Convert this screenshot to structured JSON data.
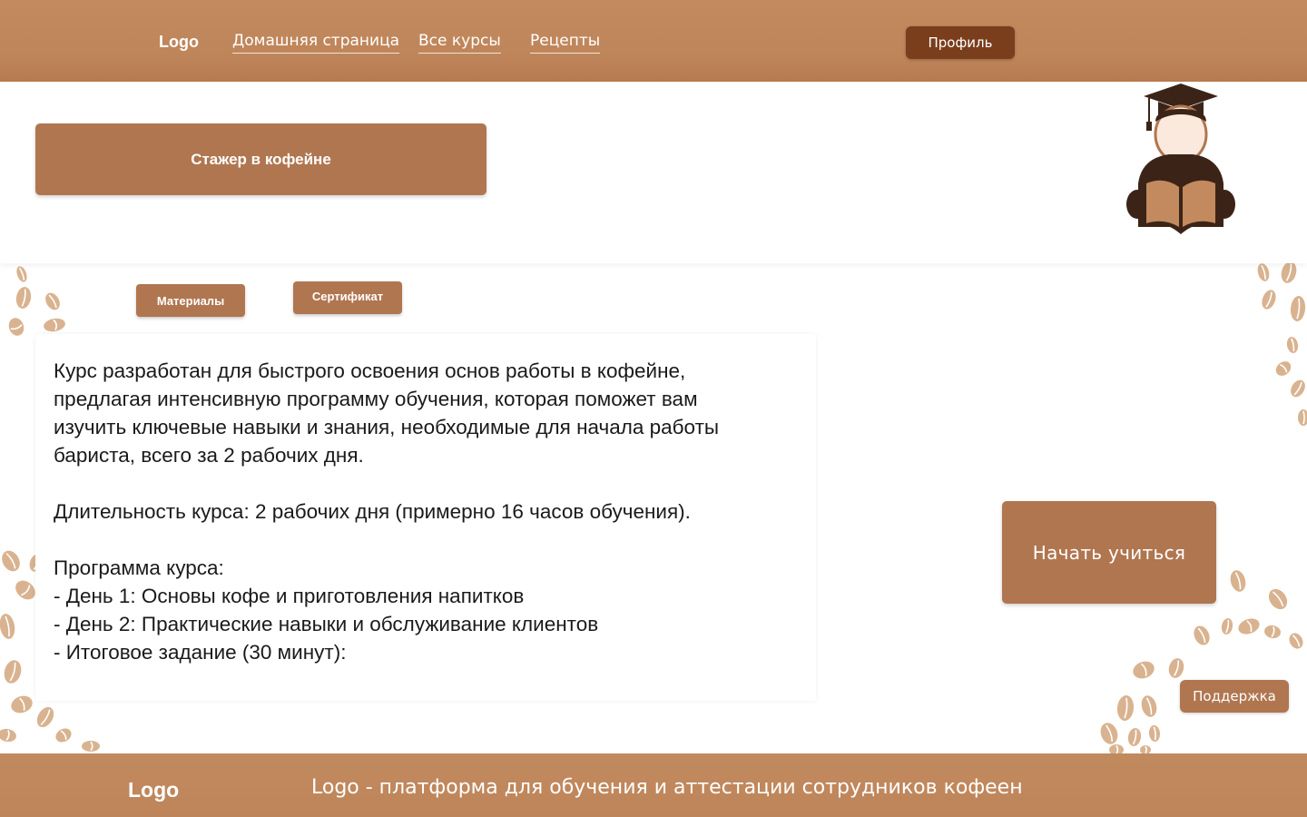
{
  "header": {
    "logo": "Logo",
    "nav": {
      "home": "Домашняя страница",
      "courses": "Все курсы",
      "recipes": "Рецепты"
    },
    "profile_label": "Профиль"
  },
  "course": {
    "title": "Стажер в кофейне",
    "illustration_icon": "graduate-reading-book-icon"
  },
  "tabs": {
    "materials": "Материалы",
    "certificate": "Сертификат"
  },
  "description": {
    "intro_lines": [
      "Курс разработан для быстрого освоения основ работы в кофейне,",
      "предлагая интенсивную программу обучения, которая поможет вам",
      "изучить ключевые навыки и знания, необходимые для начала работы",
      "бариста, всего за 2 рабочих дня."
    ],
    "duration": "Длительность курса: 2 рабочих дня (примерно 16 часов обучения).",
    "program_heading": "Программа курса:",
    "program_items": [
      "- День 1: Основы кофе и приготовления напитков",
      "- День 2: Практические навыки и обслуживание клиентов",
      "- Итоговое задание (30 минут):"
    ]
  },
  "actions": {
    "start_label": "Начать учиться",
    "support_label": "Поддержка"
  },
  "footer": {
    "logo": "Logo",
    "tagline": "Logo - платформа для обучения и аттестации сотрудников кофеен"
  },
  "colors": {
    "header_bg": "#bf855a",
    "accent": "#b07650",
    "profile_bg": "#7a3e1c",
    "bean": "#d9b390"
  }
}
